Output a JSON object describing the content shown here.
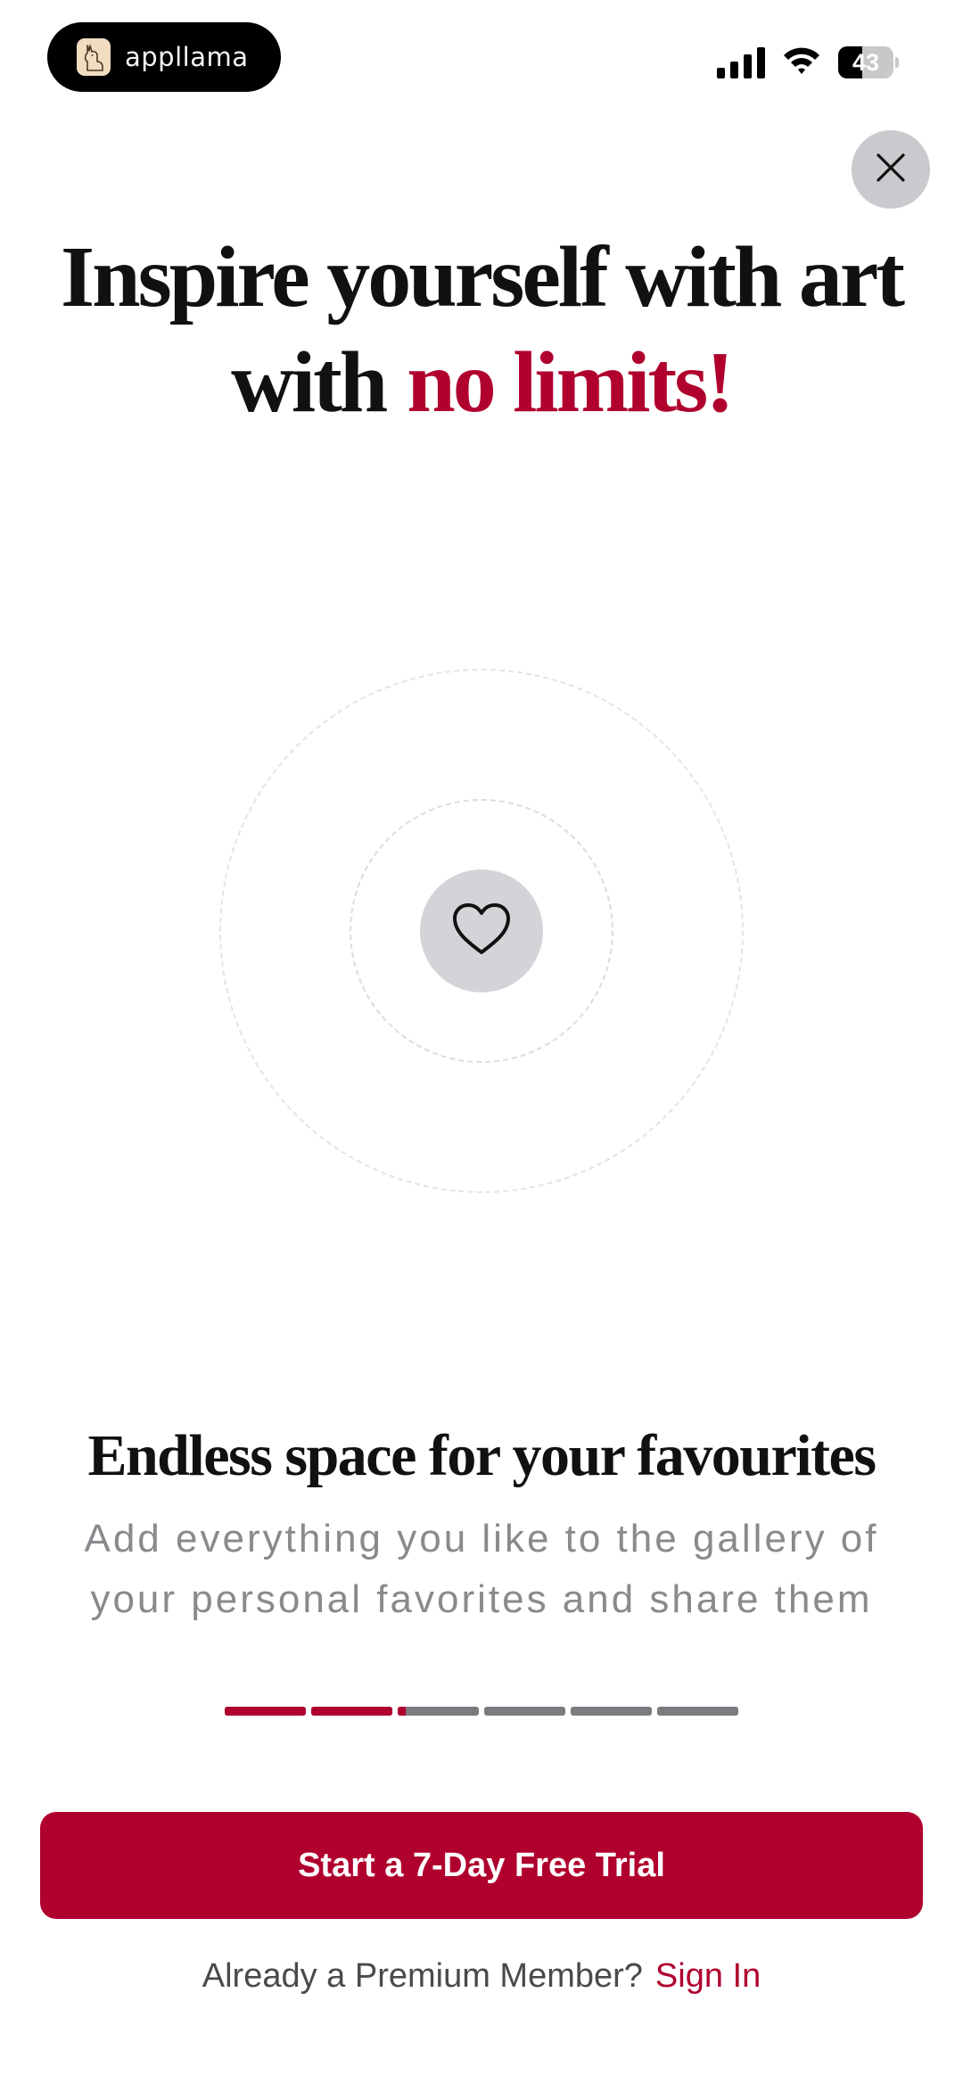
{
  "status_bar": {
    "brand_name": "appllama",
    "battery_level": "43",
    "battery_percent": 43,
    "signal_bars_filled": 4
  },
  "headline": {
    "line1": "Inspire yourself with art",
    "line2_prefix": "with",
    "line2_accent": "no limits!"
  },
  "feature": {
    "title": "Endless space for your favourites",
    "description_line1": "Add everything you like to the gallery of",
    "description_line2": "your personal favorites and share them"
  },
  "progress": {
    "segments": [
      1,
      1,
      0.1,
      0,
      0,
      0
    ]
  },
  "cta": {
    "label": "Start a 7-Day Free Trial"
  },
  "signin": {
    "prompt": "Already a Premium Member?",
    "link": "Sign In"
  },
  "icons": {
    "close": "close-icon",
    "heart": "heart-icon",
    "brand": "llama-logo-icon",
    "signal": "cellular-signal-icon",
    "wifi": "wifi-icon",
    "battery": "battery-icon"
  },
  "colors": {
    "accent": "#b0002e",
    "text": "#111111",
    "muted": "#8a8a8e",
    "progress_inactive": "#7b7b80"
  }
}
